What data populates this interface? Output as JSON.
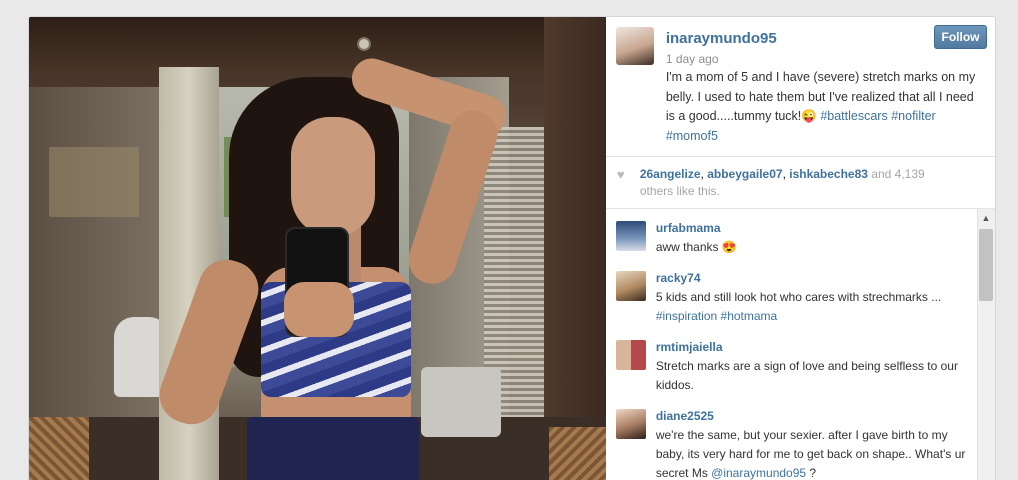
{
  "post": {
    "username": "inaraymundo95",
    "time_ago": "1 day ago",
    "follow_label": "Follow",
    "caption_text": "I'm a mom of 5 and I have (severe) stretch marks on my belly. I used to hate them but I've realized that all I need is a good.....tummy tuck!😜 ",
    "caption_tags": [
      "#battlescars",
      "#nofilter",
      "#momof5"
    ]
  },
  "likes": {
    "users": [
      "26angelize",
      "abbeygaile07",
      "ishkabeche83"
    ],
    "and_text": " and 4,139",
    "others_text": "others like this."
  },
  "comments": [
    {
      "user": "urfabmama",
      "text": "aww thanks 😍",
      "avatar_color": "#5a7dab"
    },
    {
      "user": "racky74",
      "text": "5 kids and still look hot who cares with strechmarks ... ",
      "tags": [
        "#inspiration",
        "#hotmama"
      ],
      "avatar_color": "#c8a67e"
    },
    {
      "user": "rmtimjaiella",
      "text": "Stretch marks are a sign of love and being selfless to our kiddos.",
      "avatar_color": "#b5484a"
    },
    {
      "user": "diane2525",
      "text": "we're the same, but your sexier. after I gave birth to my baby, its very hard for me to get back on shape.. What's ur secret Ms ",
      "mention": "@inaraymundo95",
      "suffix": " ?",
      "avatar_color": "#8a6a55"
    }
  ],
  "icons": {
    "heart": "heart-icon",
    "scroll_up": "chevron-up-icon"
  },
  "colors": {
    "link": "#3f729b",
    "follow_button": "#52799e"
  }
}
